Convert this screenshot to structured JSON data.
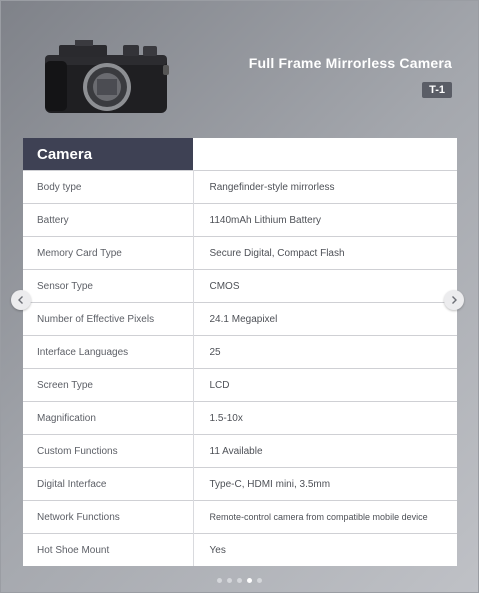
{
  "product": {
    "title": "Full Frame Mirrorless Camera",
    "model": "T-1"
  },
  "table": {
    "header": "Camera",
    "rows": [
      {
        "name": "Body type",
        "value": "Rangefinder-style mirrorless"
      },
      {
        "name": "Battery",
        "value": "1140mAh Lithium Battery"
      },
      {
        "name": "Memory Card Type",
        "value": "Secure Digital, Compact Flash"
      },
      {
        "name": "Sensor Type",
        "value": "CMOS"
      },
      {
        "name": "Number of Effective Pixels",
        "value": "24.1 Megapixel"
      },
      {
        "name": "Interface Languages",
        "value": "25"
      },
      {
        "name": "Screen Type",
        "value": "LCD"
      },
      {
        "name": "Magnification",
        "value": "1.5-10x"
      },
      {
        "name": "Custom Functions",
        "value": "11 Available"
      },
      {
        "name": "Digital Interface",
        "value": "Type-C, HDMI mini, 3.5mm"
      },
      {
        "name": "Network Functions",
        "value": "Remote-control camera from compatible mobile device"
      },
      {
        "name": "Hot Shoe Mount",
        "value": "Yes"
      }
    ]
  },
  "carousel": {
    "prev_icon": "chevron-left-icon",
    "next_icon": "chevron-right-icon",
    "slide_count": 5,
    "active_index": 3
  },
  "colors": {
    "header_bg": "#3e4154",
    "badge_bg": "#5a5d66"
  }
}
